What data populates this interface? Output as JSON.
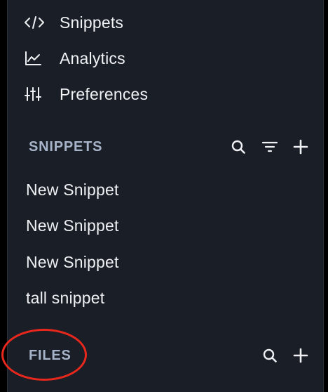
{
  "nav": {
    "items": [
      {
        "label": "Snippets",
        "icon": "code-icon"
      },
      {
        "label": "Analytics",
        "icon": "analytics-chart-icon"
      },
      {
        "label": "Preferences",
        "icon": "sliders-icon"
      }
    ]
  },
  "snippets_section": {
    "title": "SNIPPETS",
    "items": [
      {
        "label": "New Snippet"
      },
      {
        "label": "New Snippet"
      },
      {
        "label": "New Snippet"
      },
      {
        "label": "tall snippet"
      }
    ]
  },
  "files_section": {
    "title": "FILES"
  },
  "colors": {
    "panel_background": "#1a1e26",
    "section_title": "#a7b3c8",
    "text": "#eef0f3",
    "annotation": "#e8271d"
  }
}
